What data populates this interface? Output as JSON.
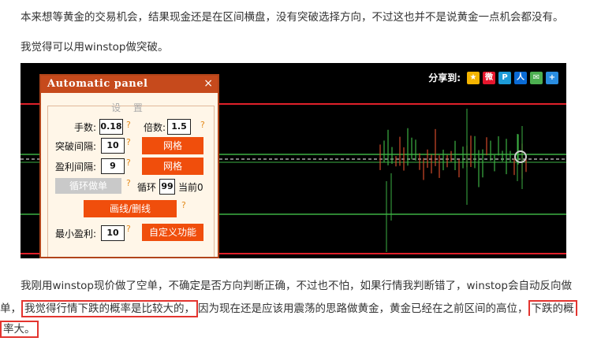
{
  "paragraphs": {
    "p1": "本来想等黄金的交易机会，结果现金还是在区间横盘，没有突破选择方向，不过这也并不是说黄金一点机会都没有。",
    "p2": "我觉得可以用winstop做突破。",
    "p3_line1": "我刚用winstop现价做了空单，不确定是否方向判断正确，不过也不怕，如果行情我判断错了，winstop会自动反向做",
    "p3_prefix": "单，",
    "p3_highlight1": "我觉得行情下跌的概率是比较大的，",
    "p3_mid": "因为现在还是应该用震荡的思路做黄金，黄金已经在之前区间的高位，",
    "p3_highlight2_a": "下跌的概",
    "p3_highlight2_b": "率大。"
  },
  "share": {
    "label": "分享到:",
    "icons": [
      "qzone-icon",
      "weibo-icon",
      "tencent-weibo-icon",
      "renren-icon",
      "wechat-icon",
      "more-share-icon"
    ]
  },
  "panel": {
    "title": "Automatic panel",
    "close": "×",
    "settings_title": "设 置",
    "lots_label": "手数:",
    "lots_value": "0.18",
    "multiplier_label": "倍数:",
    "multiplier_value": "1.5",
    "breakout_gap_label": "突破间隔:",
    "breakout_gap_value": "10",
    "grid_btn1": "网格",
    "profit_gap_label": "盈利间隔:",
    "profit_gap_value": "9",
    "grid_btn2": "网格",
    "loop_order_btn": "循环做单",
    "loop_label": "循环",
    "loop_value": "99",
    "current_label": "当前0",
    "draw_line_btn": "画线/删线",
    "min_profit_label": "最小盈利:",
    "min_profit_value": "10",
    "custom_btn": "自定义功能",
    "q": "?"
  },
  "colors": {
    "panel_header": "#c64a1c",
    "button_orange": "#f04e0c",
    "highlight_border": "#e3342f",
    "chart_bg": "#000000"
  }
}
